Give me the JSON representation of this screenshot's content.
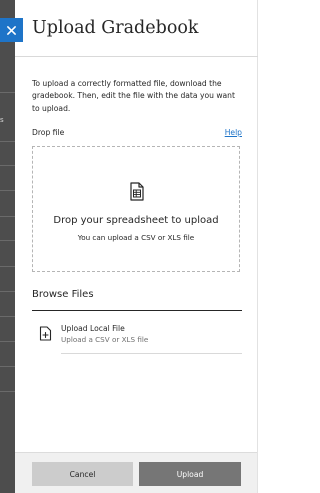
{
  "colors": {
    "accent": "#1e74c8",
    "backdrop": "#4d4d4d",
    "upload_button": "#767676",
    "cancel_button": "#cccccc",
    "footer": "#f0f0f0"
  },
  "background": {
    "fragment": "s"
  },
  "panel": {
    "close_icon": "close-icon",
    "title": "Upload Gradebook",
    "intro": "To upload a correctly formatted file, download the gradebook. Then, edit the file with the data you want to upload.",
    "drop_label": "Drop file",
    "help_link": "Help"
  },
  "dropzone": {
    "icon": "spreadsheet-icon",
    "title": "Drop your spreadsheet to upload",
    "subtitle": "You can upload a CSV or XLS file"
  },
  "browse": {
    "title": "Browse Files",
    "local": {
      "icon": "file-add-icon",
      "title": "Upload Local File",
      "subtitle": "Upload a CSV or XLS file"
    }
  },
  "footer": {
    "cancel_label": "Cancel",
    "upload_label": "Upload"
  }
}
